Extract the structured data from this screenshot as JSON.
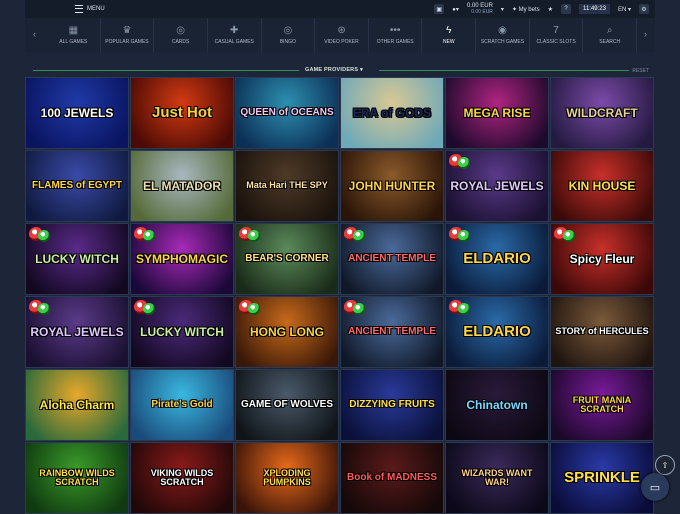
{
  "topbar": {
    "logo_text": "",
    "menu_label": "MENU",
    "balance_main": "0.00 EUR",
    "balance_sub": "0.00 EUR",
    "mybets_label": "My bets",
    "time": "11:49:23",
    "language": "EN"
  },
  "categories": [
    {
      "label": "ALL GAMES",
      "icon": "grid-icon",
      "glyph": "▦"
    },
    {
      "label": "POPULAR GAMES",
      "icon": "trophy-icon",
      "glyph": "♛"
    },
    {
      "label": "CARDS",
      "icon": "cards-icon",
      "glyph": "◎"
    },
    {
      "label": "CASUAL GAMES",
      "icon": "puzzle-icon",
      "glyph": "✚"
    },
    {
      "label": "BINGO",
      "icon": "bingo-icon",
      "glyph": "◎"
    },
    {
      "label": "VIDEO POKER",
      "icon": "poker-chip-icon",
      "glyph": "⊛"
    },
    {
      "label": "OTHER GAMES",
      "icon": "dots-icon",
      "glyph": "•••"
    },
    {
      "label": "NEW",
      "icon": "lightning-icon",
      "glyph": "ϟ"
    },
    {
      "label": "SCRATCH GAMES",
      "icon": "scratch-icon",
      "glyph": "◉"
    },
    {
      "label": "CLASSIC SLOTS",
      "icon": "seven-icon",
      "glyph": "7"
    },
    {
      "label": "SEARCH",
      "icon": "search-icon",
      "glyph": "⌕"
    }
  ],
  "providers": {
    "label": "GAME PROVIDERS",
    "reset_label": "RESET"
  },
  "games": [
    {
      "title": "100 JEWELS",
      "bg1": "#1f3aa8",
      "bg2": "#0a1460",
      "color": "#ffffff"
    },
    {
      "title": "Just Hot",
      "bg1": "#d23a12",
      "bg2": "#4a0a05",
      "color": "#ffd23a"
    },
    {
      "title": "QUEEN of OCEANS",
      "bg1": "#2c8fb0",
      "bg2": "#0c2f55",
      "color": "#f0c8f4"
    },
    {
      "title": "ERA of GODS",
      "bg1": "#d8c894",
      "bg2": "#6fa9b8",
      "color": "#1c2a5c"
    },
    {
      "title": "MEGA RISE",
      "bg1": "#b02480",
      "bg2": "#1c0a2c",
      "color": "#ffd64a"
    },
    {
      "title": "WILDCRAFT",
      "bg1": "#7b4aa8",
      "bg2": "#241a40",
      "color": "#e8d49a"
    },
    {
      "title": "FLAMES of EGYPT",
      "bg1": "#3a4aa8",
      "bg2": "#101a40",
      "color": "#ffd64a"
    },
    {
      "title": "EL MATADOR",
      "bg1": "#a8b8c0",
      "bg2": "#556a38",
      "color": "#f0e0b0"
    },
    {
      "title": "Mata Hari THE SPY",
      "bg1": "#4e3a28",
      "bg2": "#1a120c",
      "color": "#ffe0a8"
    },
    {
      "title": "JOHN HUNTER",
      "bg1": "#8a5a2a",
      "bg2": "#2a1408",
      "color": "#ffd64a"
    },
    {
      "title": "ROYAL JEWELS",
      "bg1": "#5a3a8a",
      "bg2": "#1a1030",
      "color": "#e0c8ff"
    },
    {
      "title": "KIN HOUSE",
      "bg1": "#c8302a",
      "bg2": "#3a0a08",
      "color": "#ffe04a"
    },
    {
      "title": "LUCKY WITCH",
      "bg1": "#5a2a8a",
      "bg2": "#120820",
      "color": "#c8f0a0"
    },
    {
      "title": "SYMPHOMAGIC",
      "bg1": "#a82ab8",
      "bg2": "#1a0838",
      "color": "#ffd64a"
    },
    {
      "title": "BEAR'S CORNER",
      "bg1": "#5a8a5a",
      "bg2": "#1a2a18",
      "color": "#ffe08a"
    },
    {
      "title": "ANCIENT TEMPLE",
      "bg1": "#4a6a9a",
      "bg2": "#101828",
      "color": "#ff6a6a"
    },
    {
      "title": "ELDARIO",
      "bg1": "#2a6aa8",
      "bg2": "#0a1a38",
      "color": "#ffd64a"
    },
    {
      "title": "Spicy Fleur",
      "bg1": "#c8302a",
      "bg2": "#3a0808",
      "color": "#ffffff"
    },
    {
      "title": "ROYAL JEWELS",
      "bg1": "#5a3a8a",
      "bg2": "#1a1030",
      "color": "#e0c8ff"
    },
    {
      "title": "LUCKY WITCH",
      "bg1": "#4a2a7a",
      "bg2": "#120820",
      "color": "#c8f0a0"
    },
    {
      "title": "HONG LONG",
      "bg1": "#c86a1a",
      "bg2": "#3a1808",
      "color": "#ffd64a"
    },
    {
      "title": "ANCIENT TEMPLE",
      "bg1": "#4a6a9a",
      "bg2": "#101828",
      "color": "#ff6a6a"
    },
    {
      "title": "ELDARIO",
      "bg1": "#2a6aa8",
      "bg2": "#0a1a38",
      "color": "#ffd64a"
    },
    {
      "title": "STORY of HERCULES",
      "bg1": "#7a5a3a",
      "bg2": "#201410",
      "color": "#ffffff"
    },
    {
      "title": "Aloha Charm",
      "bg1": "#e8a82a",
      "bg2": "#2a6a3a",
      "color": "#ffe84a"
    },
    {
      "title": "Pirate's Gold",
      "bg1": "#3ab8e0",
      "bg2": "#1a4a7a",
      "color": "#ffd64a"
    },
    {
      "title": "GAME OF WOLVES",
      "bg1": "#4a5a6a",
      "bg2": "#101418",
      "color": "#ffffff"
    },
    {
      "title": "DIZZYING FRUITS",
      "bg1": "#2a3a9a",
      "bg2": "#0a1038",
      "color": "#ffe04a"
    },
    {
      "title": "Chinatown",
      "bg1": "#2a1a3a",
      "bg2": "#0c0812",
      "color": "#7ad8ff"
    },
    {
      "title": "FRUIT MANIA SCRATCH",
      "bg1": "#7a1a9a",
      "bg2": "#1a0828",
      "color": "#ffd64a"
    },
    {
      "title": "RAINBOW WILDS SCRATCH",
      "bg1": "#3a9a2a",
      "bg2": "#103a10",
      "color": "#ffe04a"
    },
    {
      "title": "VIKING WILDS SCRATCH",
      "bg1": "#8a1a1a",
      "bg2": "#200808",
      "color": "#ffffff"
    },
    {
      "title": "XPLODING PUMPKINS",
      "bg1": "#e86a1a",
      "bg2": "#3a1408",
      "color": "#ffe04a"
    },
    {
      "title": "Book of MADNESS",
      "bg1": "#5a1a1a",
      "bg2": "#140808",
      "color": "#ff5a5a"
    },
    {
      "title": "WIZARDS WANT WAR!",
      "bg1": "#3a2a5a",
      "bg2": "#0c0818",
      "color": "#ffd08a"
    },
    {
      "title": "SPRINKLE",
      "bg1": "#2a3aa8",
      "bg2": "#0a0c38",
      "color": "#ffe04a"
    }
  ],
  "colors": {
    "accent": "#3fbf6f",
    "background": "#1c2638",
    "topbar": "#141c2a"
  }
}
